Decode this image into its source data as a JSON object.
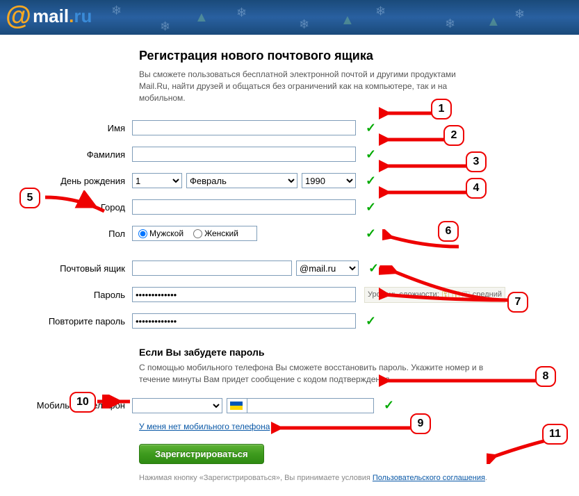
{
  "logo": {
    "at": "@",
    "mail": "mail",
    "dot": ".",
    "ru": "ru"
  },
  "title": "Регистрация нового почтового ящика",
  "subtitle": "Вы сможете пользоваться бесплатной электронной почтой и другими продуктами Mail.Ru, найти друзей и общаться без ограничений как на компьютере, так и на мобильном.",
  "labels": {
    "name": "Имя",
    "surname": "Фамилия",
    "birthday": "День рождения",
    "city": "Город",
    "gender": "Пол",
    "mailbox": "Почтовый ящик",
    "password": "Пароль",
    "password2": "Повторите пароль",
    "phone": "Мобильный телефон"
  },
  "values": {
    "name": "",
    "surname": "",
    "day": "1",
    "month": "Февраль",
    "year": "1990",
    "city": "",
    "mailbox": "",
    "domain": "@mail.ru",
    "password": "•••••••••••••",
    "password2": "•••••••••••••",
    "country": "",
    "phone": ""
  },
  "gender": {
    "male": "Мужской",
    "female": "Женский",
    "selected": "male"
  },
  "strength": {
    "label": "Уровень сложности:",
    "value": "средний"
  },
  "recovery": {
    "heading": "Если Вы забудете пароль",
    "text": "С помощью мобильного телефона Вы сможете восстановить пароль. Укажите номер и в течение минуты Вам придет сообщение с кодом подтверждения."
  },
  "no_phone_link": "У меня нет мобильного телефона",
  "register_btn": "Зарегистрироваться",
  "terms": {
    "prefix": "Нажимая кнопку «Зарегистрироваться», Вы принимаете условия ",
    "link": "Пользовательского соглашения",
    "suffix": "."
  },
  "annotations": [
    "1",
    "2",
    "3",
    "4",
    "5",
    "6",
    "7",
    "8",
    "9",
    "10",
    "11"
  ]
}
